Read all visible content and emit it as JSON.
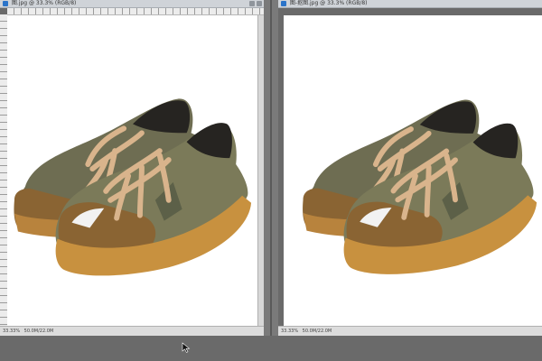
{
  "left_window": {
    "title": "图.jpg @ 33.3% (RGB/8)",
    "zoom": "33.33%",
    "status": "50.0M/22.0M"
  },
  "right_window": {
    "title": "图-抠图.jpg @ 33.3% (RGB/8)",
    "zoom": "33.33%",
    "status": "50.0M/22.0M"
  },
  "icons": {
    "document": "document-icon",
    "cursor": "cursor-arrow-icon",
    "shoe": "sneaker-image"
  },
  "colors": {
    "canvas": "#ffffff",
    "workspace": "#6a6a6a",
    "sole": "#c8913f",
    "suede": "#8a6433",
    "mesh": "#7b7a59",
    "lace": "#d9b48c"
  }
}
